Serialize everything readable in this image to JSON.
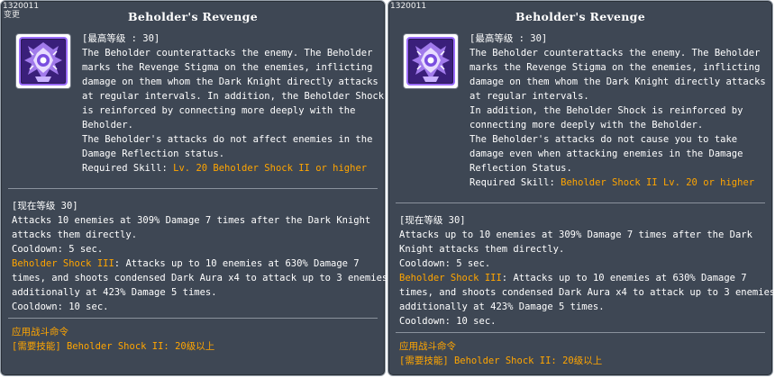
{
  "left": {
    "skill_id": "1320011",
    "tag": "变更",
    "title": "Beholder's Revenge",
    "max_level_header": "[最高等级 : 30]",
    "description_lines": [
      "The Beholder counterattacks the enemy. The Beholder",
      "marks the Revenge Stigma on the enemies, inflicting",
      "damage on them whom the Dark Knight directly attacks",
      "at regular intervals. In addition, the Beholder Shock",
      "is reinforced by connecting more deeply with the",
      "Beholder.",
      "The Beholder's attacks do not affect enemies in the",
      "Damage Reflection status."
    ],
    "required_skill_label": "Required Skill: ",
    "required_skill_value": "Lv. 20 Beholder Shock II or higher",
    "current_level_header": "[现在等级 30]",
    "stat_lines": [
      "Attacks 10 enemies at 309% Damage 7 times after the Dark Knight",
      "attacks them directly.",
      "Cooldown: 5 sec."
    ],
    "shock_name": "Beholder Shock III",
    "shock_line_rest": ": Attacks up to 10 enemies at 630% Damage 7",
    "shock_lines": [
      "times, and shoots condensed Dark Aura x4 to attack up to 3 enemies",
      "additionally at 423% Damage 5 times.",
      "Cooldown: 10 sec."
    ],
    "footer_line1": "应用战斗命令",
    "footer_line2": "[需要技能] Beholder Shock II: 20级以上"
  },
  "right": {
    "skill_id": "1320011",
    "title": "Beholder's Revenge",
    "max_level_header": "[最高等级 : 30]",
    "description_lines": [
      "The Beholder counterattacks the enemy. The Beholder",
      "marks the Revenge Stigma on the enemies, inflicting",
      "damage on them whom the Dark Knight directly attacks",
      "at regular intervals.",
      "In addition, the Beholder Shock is reinforced by",
      "connecting more deeply with the Beholder.",
      "The Beholder's attacks do not cause you to take",
      "damage even when attacking enemies in the Damage",
      "Reflection Status."
    ],
    "required_skill_label": "Required Skill: ",
    "required_skill_value": "Beholder Shock II Lv. 20 or higher",
    "current_level_header": "[现在等级 30]",
    "stat_lines": [
      "Attacks up to 10 enemies at 309% Damage 7 times after the Dark",
      "Knight attacks them directly.",
      "Cooldown: 5 sec."
    ],
    "shock_name": "Beholder Shock III",
    "shock_line_rest": ": Attacks up to 10 enemies at 630% Damage 7",
    "shock_lines": [
      "times, and shoots condensed Dark Aura x4 to attack up to 3 enemies",
      "additionally at 423% Damage 5 times.",
      "Cooldown: 10 sec."
    ],
    "footer_line1": "应用战斗命令",
    "footer_line2": "[需要技能] Beholder Shock II: 20级以上"
  },
  "colors": {
    "panel_bg": "#3e4754",
    "text": "#ffffff",
    "highlight": "#ffa500",
    "divider": "#8a929c"
  },
  "icons": {
    "skill_icon": "beholder-revenge-icon"
  }
}
